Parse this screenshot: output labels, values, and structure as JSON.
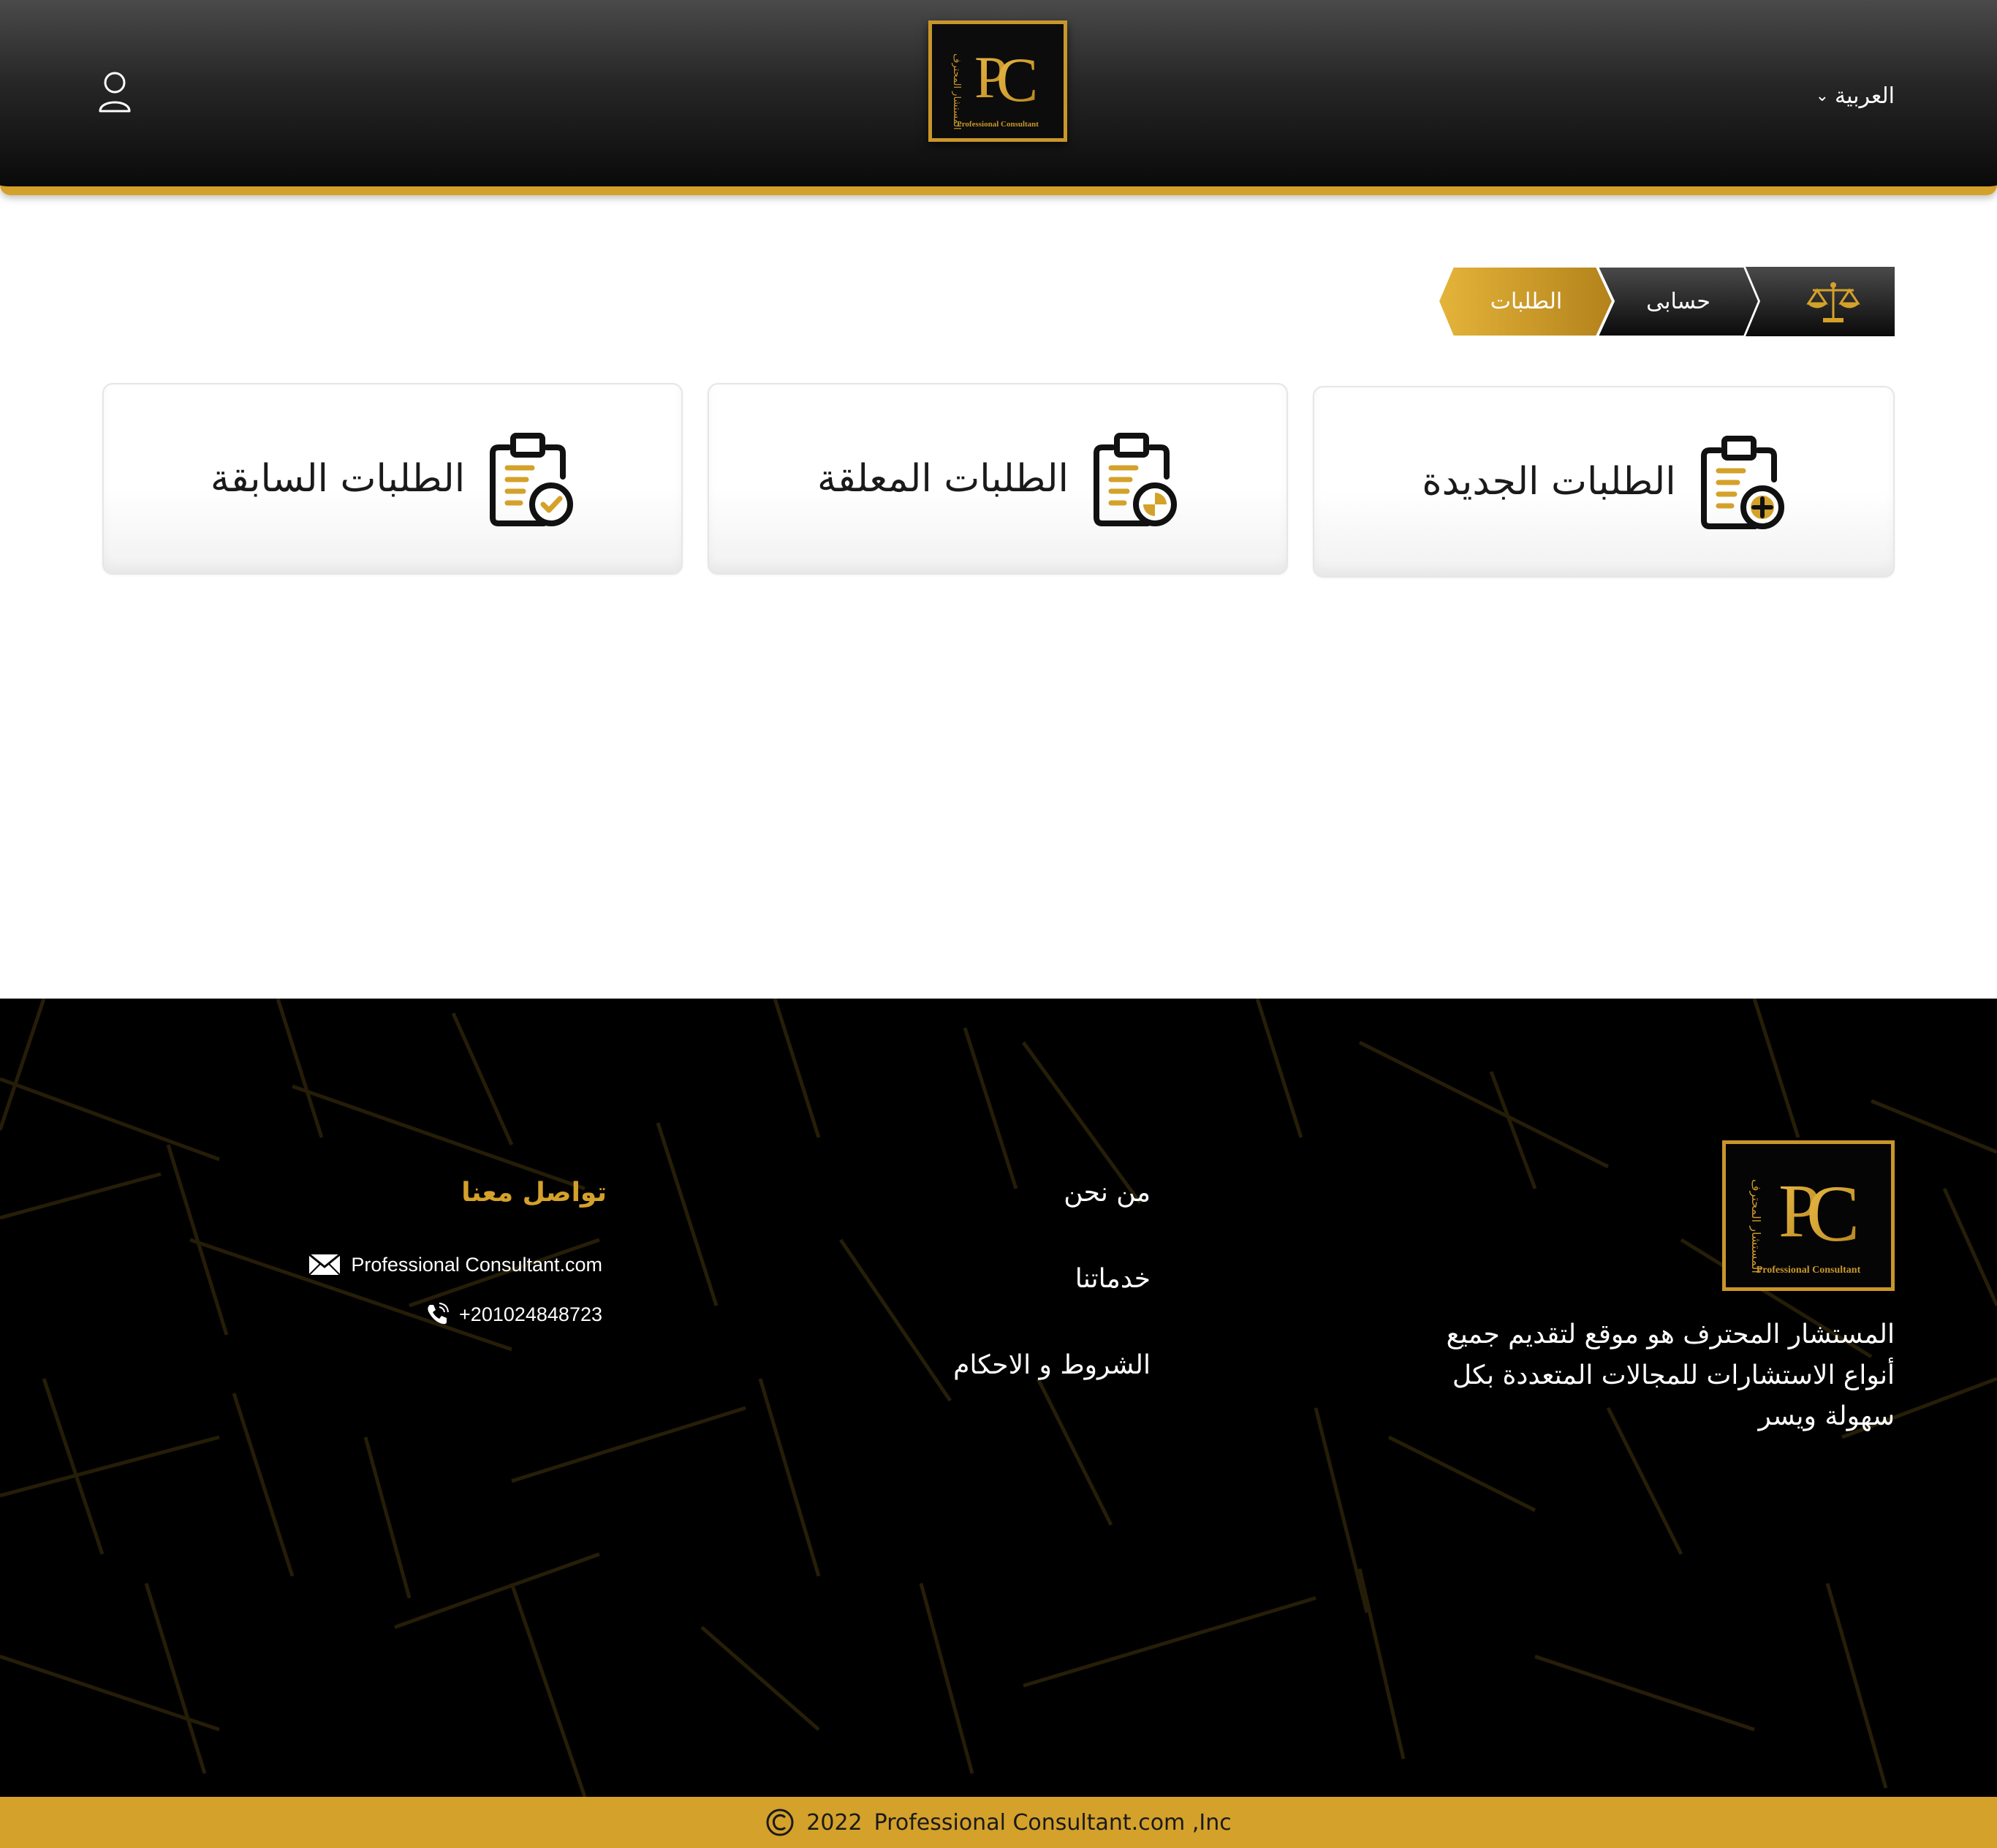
{
  "header": {
    "language": "العربية",
    "logo_text": "Professional Consultant",
    "logo_arabic": "المستشار المحترف",
    "logo_mark": "PC"
  },
  "breadcrumb": {
    "items": [
      "حسابى",
      "الطلبات"
    ]
  },
  "cards": [
    {
      "label": "الطلبات الجديدة",
      "icon": "clipboard-plus-icon"
    },
    {
      "label": "الطلبات المعلقة",
      "icon": "clipboard-clock-icon"
    },
    {
      "label": "الطلبات السابقة",
      "icon": "clipboard-check-icon"
    }
  ],
  "footer": {
    "about": "المستشار المحترف هو موقع لتقديم جميع أنواع الاستشارات للمجالات المتعددة بكل سهولة ويسر",
    "links": [
      "من نحن",
      "خدماتنا",
      "الشروط و الاحكام"
    ],
    "contact_title": "تواصل معنا",
    "email": "Professional Consultant.com",
    "phone": "+201024848723",
    "copyright_year": "2022",
    "copyright_text": "Professional Consultant.com ,Inc"
  },
  "colors": {
    "gold": "#d4a12a",
    "dark": "#0a0a0a"
  }
}
